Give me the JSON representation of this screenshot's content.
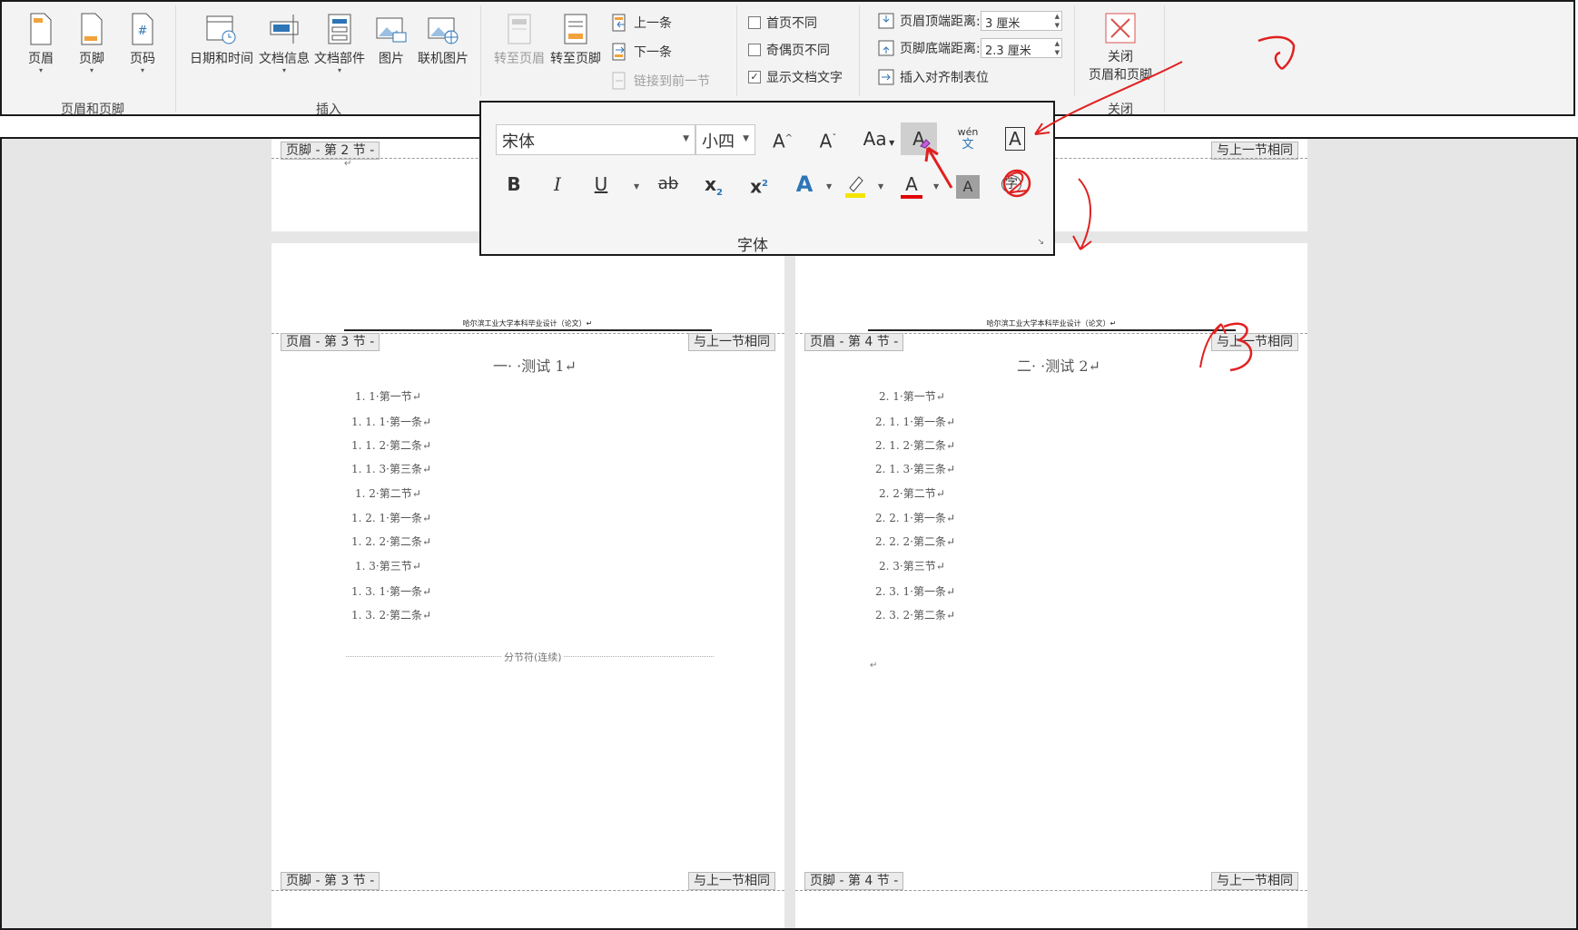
{
  "ribbon": {
    "groups": {
      "header_footer": {
        "label": "页眉和页脚",
        "header": "页眉",
        "footer": "页脚",
        "page_number": "页码"
      },
      "insert": {
        "label": "插入",
        "datetime": "日期和时间",
        "docinfo": "文档信息",
        "quickparts": "文档部件",
        "picture": "图片",
        "online_picture": "联机图片"
      },
      "navigation": {
        "goto_header": "转至页眉",
        "goto_footer": "转至页脚",
        "previous": "上一条",
        "next": "下一条",
        "link_previous": "链接到前一节"
      },
      "options": {
        "different_first": "首页不同",
        "different_odd_even": "奇偶页不同",
        "show_doc_text": "显示文档文字",
        "show_doc_text_checked": true
      },
      "position": {
        "header_top_label": "页眉顶端距离:",
        "header_top_value": "3 厘米",
        "footer_bottom_label": "页脚底端距离:",
        "footer_bottom_value": "2.3 厘米",
        "insert_align_tab": "插入对齐制表位"
      },
      "close": {
        "label": "关闭",
        "button_line1": "关闭",
        "button_line2": "页眉和页脚"
      }
    }
  },
  "font_popup": {
    "font_name": "宋体",
    "font_size": "小四",
    "grow": "A",
    "shrink": "A",
    "change_case": "Aa",
    "clear_format": "A",
    "phonetic_top": "wén",
    "phonetic_bottom": "文",
    "border": "A",
    "bold": "B",
    "italic": "I",
    "underline": "U",
    "strike": "ab",
    "subscript": "x",
    "superscript": "x",
    "text_effect": "A",
    "font_color": "A",
    "shading": "A",
    "enclose": "字",
    "title": "字体",
    "colors": {
      "highlight": "#f5e400",
      "font_color": "#e00000",
      "accent": "#2e75b6"
    }
  },
  "pages": {
    "top_footer_tag": "页脚 - 第 2 节 -",
    "top_same_tag": "与上一节相同",
    "left": {
      "header_text": "哈尔滨工业大学本科毕业设计（论文）↵",
      "header_tag": "页眉 - 第 3 节 -",
      "same_tag": "与上一节相同",
      "title": "一· ·测试 1↵",
      "lines": [
        "1. 1·第一节↵",
        "1. 1. 1·第一条↵",
        "1. 1. 2·第二条↵",
        "1. 1. 3·第三条↵",
        "1. 2·第二节↵",
        "1. 2. 1·第一条↵",
        "1. 2. 2·第二条↵",
        "1. 3·第三节↵",
        "1. 3. 1·第一条↵",
        "1. 3. 2·第二条↵"
      ],
      "section_break": "分节符(连续)",
      "footer_tag": "页脚 - 第 3 节 -",
      "footer_same": "与上一节相同"
    },
    "right": {
      "header_text": "哈尔滨工业大学本科毕业设计（论文）↵",
      "header_tag": "页眉 - 第 4 节 -",
      "same_tag": "与上一节相同",
      "title": "二· ·测试 2↵",
      "lines": [
        "2. 1·第一节↵",
        "2. 1. 1·第一条↵",
        "2. 1. 2·第二条↵",
        "2. 1. 3·第三条↵",
        "2. 2·第二节↵",
        "2. 2. 1·第一条↵",
        "2. 2. 2·第二条↵",
        "2. 3·第三节↵",
        "2. 3. 1·第一条↵",
        "2. 3. 2·第二条↵"
      ],
      "footer_tag": "页脚 - 第 4 节 -",
      "footer_same": "与上一节相同"
    }
  }
}
